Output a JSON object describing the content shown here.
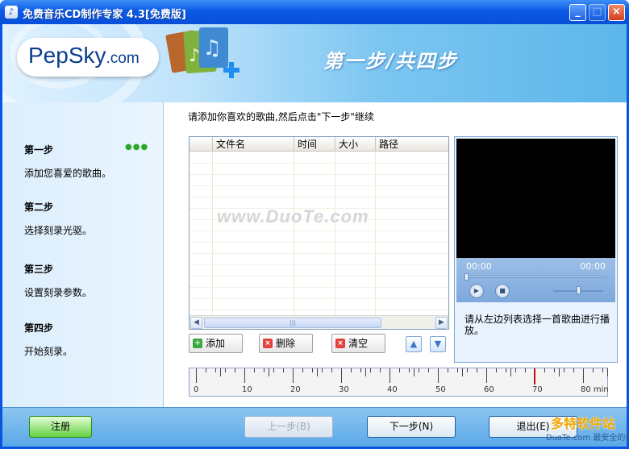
{
  "window": {
    "title": "免费音乐CD制作专家 4.3[免费版]",
    "minimize": "_",
    "maximize": "□",
    "close": "×"
  },
  "banner": {
    "logo_main": "PepSky",
    "logo_suffix": ".com",
    "step_title": "第一步/共四步"
  },
  "sidebar": {
    "steps": [
      {
        "heading": "第一步",
        "desc": "添加您喜爱的歌曲。"
      },
      {
        "heading": "第二步",
        "desc": "选择刻录光驱。"
      },
      {
        "heading": "第三步",
        "desc": "设置刻录参数。"
      },
      {
        "heading": "第四步",
        "desc": "开始刻录。"
      }
    ],
    "current_indicator": "●●●"
  },
  "main": {
    "instruction": "请添加你喜欢的歌曲,然后点击\"下一步\"继续",
    "columns": [
      "文件名",
      "时间",
      "大小",
      "路径"
    ],
    "watermark": "www.DuoTe.com",
    "buttons": {
      "add": "添加",
      "delete": "删除",
      "clear": "清空"
    }
  },
  "player": {
    "time_current": "00:00",
    "time_total": "00:00",
    "message": "请从左边列表选择一首歌曲进行播放。",
    "seek_fraction": 0,
    "volume_fraction": 0.5
  },
  "ruler": {
    "labels": [
      "0",
      "10",
      "20",
      "30",
      "40",
      "50",
      "60",
      "70",
      "80 min"
    ],
    "marker_value_min": 70
  },
  "footer": {
    "register": "注册",
    "prev": "上一步(B)",
    "next": "下一步(N)",
    "exit": "退出(E)",
    "logo_line1": "多特软件站",
    "logo_line2": "DuoTe.com 最安全的软件站"
  },
  "colors": {
    "title_bar": "#0b5ae6",
    "banner_accent": "#5cb6ea",
    "marker": "#cc1010",
    "register_button": "#62d040"
  }
}
